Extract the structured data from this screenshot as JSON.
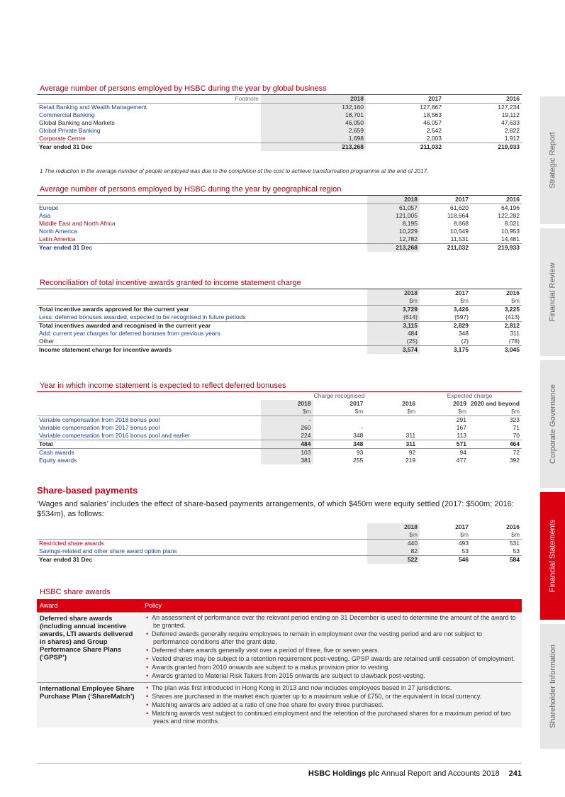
{
  "side_tabs": [
    {
      "label": "Strategic Report",
      "active": false
    },
    {
      "label": "Financial Review",
      "active": false
    },
    {
      "label": "Corporate Governance",
      "active": false
    },
    {
      "label": "Financial Statements",
      "active": true
    },
    {
      "label": "Shareholder Information",
      "active": false
    }
  ],
  "global_business": {
    "title": "Average number of persons employed by HSBC during the year by global business",
    "footnote_marker": "Footnote",
    "years": [
      "2018",
      "2017",
      "2016"
    ],
    "rows": [
      {
        "label": "Retail Banking and Wealth Management",
        "values": [
          "132,160",
          "127,867",
          "127,234"
        ]
      },
      {
        "label": "Commercial Banking",
        "values": [
          "18,701",
          "18,563",
          "19,112"
        ]
      },
      {
        "label": "Global Banking and Markets",
        "values": [
          "46,050",
          "46,057",
          "47,633"
        ]
      },
      {
        "label": "Global Private Banking",
        "values": [
          "2,659",
          "2,542",
          "2,822"
        ]
      },
      {
        "label": "Corporate Centre",
        "values": [
          "1,698",
          "2,003",
          "1,912"
        ]
      },
      {
        "label": "Year ended 31 Dec",
        "values": [
          "213,268",
          "211,032",
          "219,933"
        ]
      }
    ],
    "note": "1   The reduction in the average number of people employed was due to the completion of the cost to achieve transformation programme at the end of 2017."
  },
  "geo_region": {
    "title": "Average number of persons employed by HSBC during the year by geographical region",
    "years": [
      "2018",
      "2017",
      "2016"
    ],
    "rows": [
      {
        "label": "Europe",
        "values": [
          "61,057",
          "61,620",
          "64,196"
        ]
      },
      {
        "label": "Asia",
        "values": [
          "121,005",
          "118,664",
          "122,282"
        ]
      },
      {
        "label": "Middle East and North Africa",
        "values": [
          "8,195",
          "8,668",
          "8,021"
        ]
      },
      {
        "label": "North America",
        "values": [
          "10,229",
          "10,549",
          "10,953"
        ]
      },
      {
        "label": "Latin America",
        "values": [
          "12,782",
          "11,531",
          "14,481"
        ]
      },
      {
        "label": "Year ended 31 Dec",
        "values": [
          "213,268",
          "211,032",
          "219,933"
        ]
      }
    ]
  },
  "reconciliation": {
    "title": "Reconciliation of total incentive awards granted to income statement charge",
    "years": [
      "2018",
      "2017",
      "2016"
    ],
    "units": [
      "$m",
      "$m",
      "$m"
    ],
    "rows": [
      {
        "label": "Total incentive awards approved for the current year",
        "values": [
          "3,729",
          "3,426",
          "3,225"
        ]
      },
      {
        "label": "Less: deferred bonuses awarded, expected to be recognised in future periods",
        "values": [
          "(614)",
          "(597)",
          "(413)"
        ]
      },
      {
        "label": "Total incentives awarded and recognised in the current year",
        "values": [
          "3,115",
          "2,829",
          "2,812"
        ]
      },
      {
        "label": "Add: current year charges for deferred bonuses from previous years",
        "values": [
          "484",
          "348",
          "311"
        ]
      },
      {
        "label": "Other",
        "values": [
          "(25)",
          "(2)",
          "(78)"
        ]
      },
      {
        "label": "Income statement charge for incentive awards",
        "values": [
          "3,574",
          "3,175",
          "3,045"
        ]
      }
    ]
  },
  "deferred": {
    "title": "Year in which income statement is expected to reflect deferred bonuses",
    "group_current": "Charge recognised",
    "group_expected": "Expected charge",
    "years": [
      "2018",
      "2017",
      "2016",
      "2019",
      "2020 and beyond"
    ],
    "units": [
      "$m",
      "$m",
      "$m",
      "$m",
      "$m"
    ],
    "rows": [
      {
        "label": "Variable compensation from 2018 bonus pool",
        "values": [
          "-",
          "",
          "",
          "291",
          "323"
        ]
      },
      {
        "label": "Variable compensation from 2017 bonus pool",
        "values": [
          "260",
          "-",
          "",
          "167",
          "71"
        ]
      },
      {
        "label": "Variable compensation from 2016 bonus pool and earlier",
        "values": [
          "224",
          "348",
          "311",
          "113",
          "70"
        ]
      },
      {
        "label": "Total",
        "values": [
          "484",
          "348",
          "311",
          "571",
          "464"
        ]
      },
      {
        "label": "Cash awards",
        "values": [
          "103",
          "93",
          "92",
          "94",
          "72"
        ]
      },
      {
        "label": "Equity awards",
        "values": [
          "381",
          "255",
          "219",
          "477",
          "392"
        ]
      }
    ]
  },
  "share_based": {
    "heading": "Share-based payments",
    "paragraph": "‘Wages and salaries’ includes the effect of share-based payments arrangements, of which $450m were equity settled (2017: $500m; 2016: $534m), as follows:",
    "years": [
      "2018",
      "2017",
      "2016"
    ],
    "units": [
      "$m",
      "$m",
      "$m"
    ],
    "rows": [
      {
        "label": "Restricted share awards",
        "values": [
          "440",
          "493",
          "531"
        ]
      },
      {
        "label": "Savings-related and other share award option plans",
        "values": [
          "82",
          "53",
          "53"
        ]
      },
      {
        "label": "Year ended 31 Dec",
        "values": [
          "522",
          "546",
          "584"
        ]
      }
    ]
  },
  "awards": {
    "title": "HSBC share awards",
    "head_award": "Award",
    "head_policy": "Policy",
    "rows": [
      {
        "name": "Deferred share awards (including annual incentive awards, LTI awards delivered in shares) and Group Performance Share Plans (‘GPSP’)",
        "items": [
          "An assessment of performance over the relevant period ending on 31 December is used to determine the amount of the award to be granted.",
          "Deferred awards generally require employees to remain in employment over the vesting period and are not subject to performance conditions after the grant date.",
          "Deferred share awards generally vest over a period of three, five or seven years.",
          "Vested shares may be subject to a retention requirement post-vesting. GPSP awards are retained until cessation of employment.",
          "Awards granted from 2010 onwards are subject to a malus provision prior to vesting.",
          "Awards granted to Material Risk Takers from 2015 onwards are subject to clawback post-vesting."
        ]
      },
      {
        "name": "International Employee Share Purchase Plan (‘ShareMatch’)",
        "items": [
          "The plan was first introduced in Hong Kong in 2013 and now includes employees based in 27 jurisdictions.",
          "Shares are purchased in the market each quarter up to a maximum value of £750, or the equivalent in local currency.",
          "Matching awards are added at a ratio of one free share for every three purchased.",
          "Matching awards vest subject to continued employment and the retention of the purchased shares for a maximum period of two years and nine months."
        ]
      }
    ]
  },
  "footer": {
    "company": "HSBC Holdings plc",
    "report": "Annual Report and Accounts 2018",
    "page": "241"
  }
}
